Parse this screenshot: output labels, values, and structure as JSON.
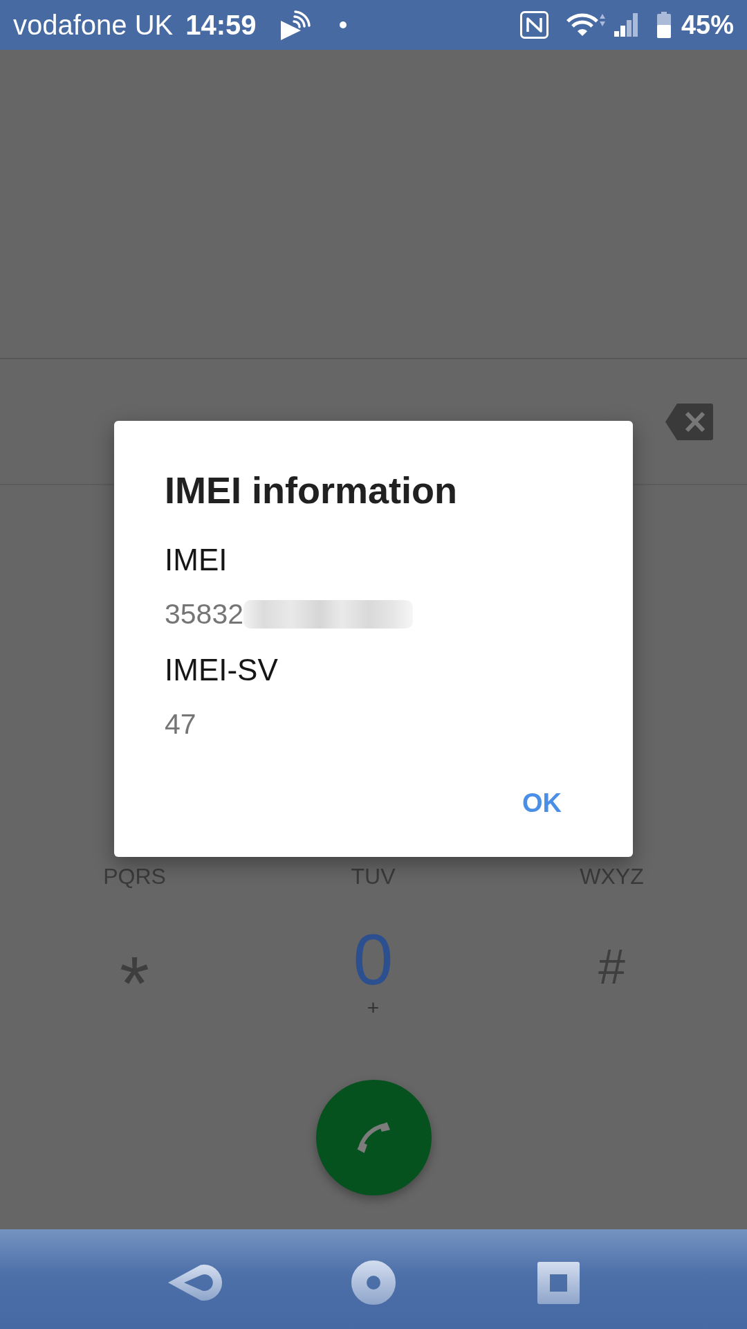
{
  "status_bar": {
    "carrier": "vodafone UK",
    "time": "14:59",
    "battery": "45%"
  },
  "dialer": {
    "key_letters": [
      "PQRS",
      "TUV",
      "WXYZ"
    ],
    "keys": [
      {
        "label": "*",
        "highlighted": false
      },
      {
        "label": "0",
        "sub": "+",
        "highlighted": true
      },
      {
        "label": "#",
        "highlighted": false
      }
    ]
  },
  "dialog": {
    "title": "IMEI information",
    "fields": [
      {
        "label": "IMEI",
        "value": "35832",
        "redacted": true
      },
      {
        "label": "IMEI-SV",
        "value": "47",
        "redacted": false
      }
    ],
    "button": "OK"
  }
}
